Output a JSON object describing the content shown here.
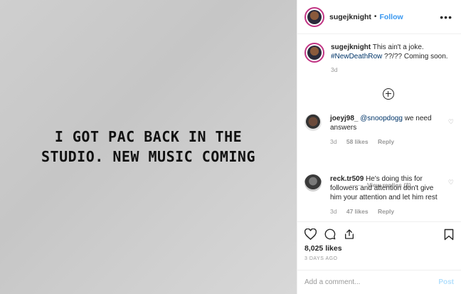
{
  "media": {
    "text": "I GOT PAC BACK IN THE\nSTUDIO. NEW MUSIC COMING"
  },
  "header": {
    "username": "sugejknight",
    "separator": "•",
    "follow": "Follow",
    "more": "•••"
  },
  "caption": {
    "username": "sugejknight",
    "text1": "This ain't a joke.",
    "hashtag": "#NewDeathRow",
    "text2": "??/?? Coming soon.",
    "time": "3d"
  },
  "comments": [
    {
      "username": "joeyj98_",
      "mention": "@snoopdogg",
      "text": "we need answers",
      "time": "3d",
      "likes": "58 likes",
      "reply": "Reply"
    },
    {
      "username": "reck.tr509",
      "text": "He's doing this for followers and attention don't give him your attention and let him rest",
      "time": "3d",
      "likes": "47 likes",
      "reply": "Reply"
    }
  ],
  "view_replies": "View replies (3)",
  "actions": {
    "likes": "8,025 likes",
    "ago": "3 DAYS AGO"
  },
  "add_comment": {
    "placeholder": "Add a comment...",
    "post": "Post"
  },
  "icons": [
    "plus-circle-icon",
    "heart-icon",
    "comment-icon",
    "share-icon",
    "bookmark-icon",
    "more-icon"
  ],
  "colors": {
    "link": "#3897f0",
    "hashtag": "#003569",
    "muted": "#999999",
    "post_disabled": "#b2dffc"
  }
}
